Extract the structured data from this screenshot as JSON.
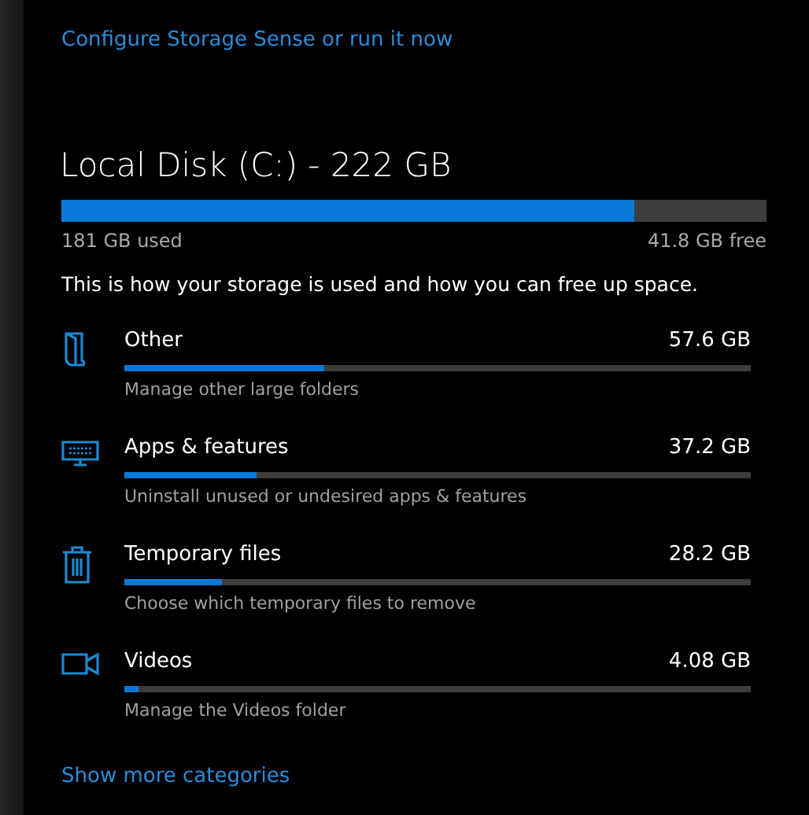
{
  "storage_sense_link": "Configure Storage Sense or run it now",
  "disk": {
    "title": "Local Disk (C:) - 222 GB",
    "level": 0.813,
    "used": "181 GB used",
    "free": "41.8 GB free"
  },
  "description": "This is how your storage is used and how you can free up space.",
  "categories": [
    {
      "kind": "folder",
      "name": "Other",
      "size": "57.6 GB",
      "level": 0.32,
      "subtitle": "Manage other large folders"
    },
    {
      "kind": "apps",
      "name": "Apps & features",
      "size": "37.2 GB",
      "level": 0.21,
      "subtitle": "Uninstall unused or undesired apps & features"
    },
    {
      "kind": "trash",
      "name": "Temporary files",
      "size": "28.2 GB",
      "level": 0.156,
      "subtitle": "Choose which temporary files to remove"
    },
    {
      "kind": "video",
      "name": "Videos",
      "size": "4.08 GB",
      "level": 0.023,
      "subtitle": "Manage the Videos folder"
    }
  ],
  "more_link": "Show more categories"
}
